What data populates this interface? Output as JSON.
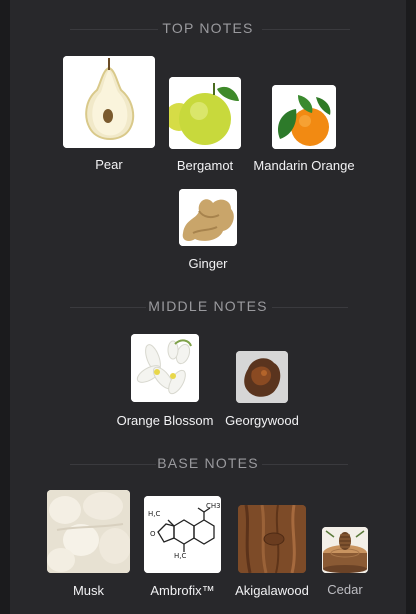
{
  "sections": {
    "top": {
      "title": "TOP NOTES",
      "notes": [
        {
          "name": "Pear"
        },
        {
          "name": "Bergamot"
        },
        {
          "name": "Mandarin Orange"
        },
        {
          "name": "Ginger"
        }
      ]
    },
    "middle": {
      "title": "MIDDLE NOTES",
      "notes": [
        {
          "name": "Orange Blossom"
        },
        {
          "name": "Georgywood"
        }
      ]
    },
    "base": {
      "title": "BASE NOTES",
      "notes": [
        {
          "name": "Musk"
        },
        {
          "name": "Ambrofix™"
        },
        {
          "name": "Akigalawood"
        },
        {
          "name": "Cedar"
        }
      ]
    }
  },
  "colors": {
    "background": "#1b1b1d",
    "panel": "#28282b",
    "section_title": "#9a9a9e",
    "label": "#f2f2f4"
  }
}
